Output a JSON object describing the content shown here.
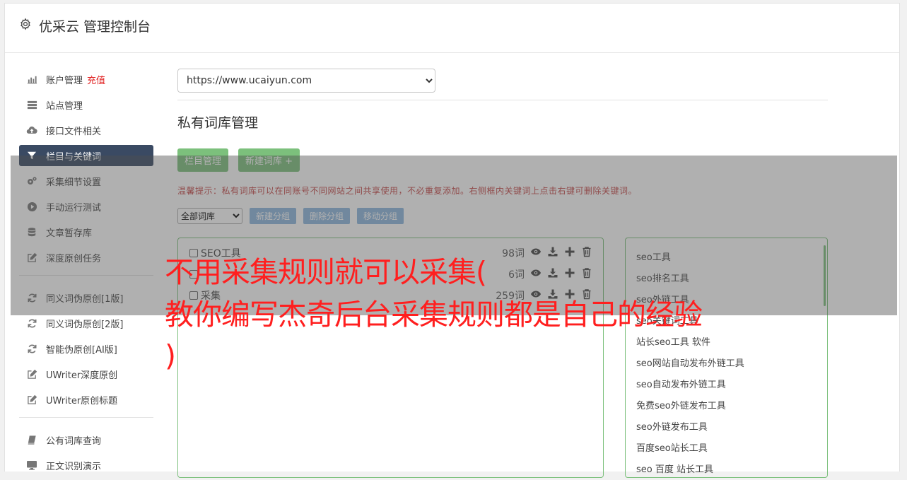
{
  "header": {
    "title": "优采云 管理控制台"
  },
  "sidebar": {
    "group1": [
      {
        "label": "账户管理",
        "badge": "充值",
        "icon": "bar-chart-icon"
      },
      {
        "label": "站点管理",
        "icon": "server-icon"
      },
      {
        "label": "接口文件相关",
        "icon": "cloud-upload-icon"
      },
      {
        "label": "栏目与关键词",
        "icon": "filter-icon",
        "active": true
      },
      {
        "label": "采集细节设置",
        "icon": "gears-icon"
      },
      {
        "label": "手动运行测试",
        "icon": "play-circle-icon"
      },
      {
        "label": "文章暂存库",
        "icon": "database-icon"
      },
      {
        "label": "深度原创任务",
        "icon": "edit-icon"
      }
    ],
    "group2": [
      {
        "label": "同义词伪原创[1版]",
        "icon": "refresh-icon"
      },
      {
        "label": "同义词伪原创[2版]",
        "icon": "refresh-icon"
      },
      {
        "label": "智能伪原创[AI版]",
        "icon": "refresh-icon"
      },
      {
        "label": "UWriter深度原创",
        "icon": "edit-icon"
      },
      {
        "label": "UWriter原创标题",
        "icon": "edit-icon"
      }
    ],
    "group3": [
      {
        "label": "公有词库查询",
        "icon": "book-icon"
      },
      {
        "label": "正文识别演示",
        "icon": "monitor-icon"
      }
    ]
  },
  "main": {
    "site_select": "https://www.ucaiyun.com",
    "section_title": "私有词库管理",
    "btn_column": "栏目管理",
    "btn_new_lib": "新建词库 +",
    "hint": "温馨提示：私有词库可以在同账号不同网站之间共享使用，不必重复添加。右侧框内关键词上点击右键可删除关键词。",
    "filter_select": "全部词库",
    "btn_new_group": "新建分组",
    "btn_del_group": "删除分组",
    "btn_move_group": "移动分组",
    "libraries": [
      {
        "name": "SEO工具",
        "count": "98词"
      },
      {
        "name": "",
        "count": "6词"
      },
      {
        "name": "采集",
        "count": "259词"
      }
    ],
    "keywords": [
      "seo工具",
      "seo排名工具",
      "seo外链工具",
      "seo关键词工具",
      "站长seo工具 软件",
      "seo网站自动发布外链工具",
      "seo自动发布外链工具",
      "免费seo外链发布工具",
      "seo外链发布工具",
      "百度seo站长工具",
      "seo 百度 站长工具"
    ]
  },
  "watermark": {
    "line1": "不用采集规则就可以采集(",
    "line2": "教你编写杰奇后台采集规则都是自己的经验",
    "line3": ")"
  },
  "colors": {
    "green": "#7cc07c",
    "blue": "#8db6de",
    "active_nav": "#3a4a63",
    "watermark": "#ff1f1f"
  }
}
